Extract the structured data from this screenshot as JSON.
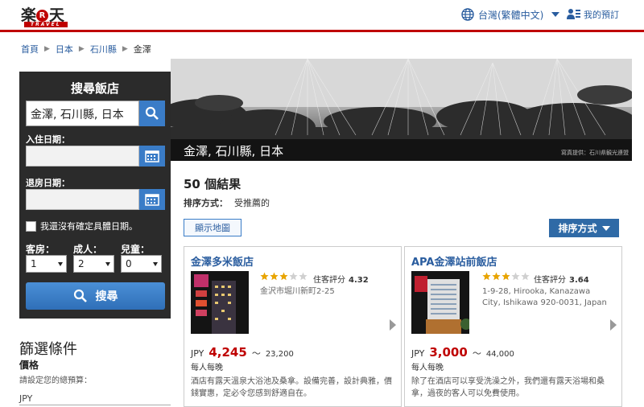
{
  "header": {
    "logo_main_a": "楽",
    "logo_r": "R",
    "logo_main_b": "天",
    "logo_sub": "TRAVEL",
    "language": "台灣(繁體中文)",
    "my_booking": "我的預訂"
  },
  "breadcrumb": [
    "首頁",
    "日本",
    "石川縣",
    "金澤"
  ],
  "search": {
    "title": "搜尋飯店",
    "destination": "金澤, 石川縣, 日本",
    "checkin_label": "入住日期：",
    "checkout_label": "退房日期：",
    "no_date_label": "我還沒有確定具體日期。",
    "rooms_label": "客房：",
    "adults_label": "成人：",
    "children_label": "兒童：",
    "rooms_value": "1",
    "adults_value": "2",
    "children_value": "0",
    "button_label": "搜尋"
  },
  "filter": {
    "title": "篩選條件",
    "price_label": "價格",
    "price_desc": "請設定您的總預算：",
    "currency": "JPY"
  },
  "hero": {
    "title": "金澤, 石川縣, 日本",
    "credit": "寫真提供：石川県観光連盟"
  },
  "results": {
    "count": "50 個結果",
    "sort_label": "排序方式：",
    "sort_value": "受推薦的",
    "map_button": "顯示地圖",
    "sort_button": "排序方式"
  },
  "hotels": [
    {
      "name": "金澤多米飯店",
      "stars": 3,
      "rating_label": "住客評分",
      "rating": "4.32",
      "address": "金沢市堀川新町2-25",
      "currency": "JPY",
      "price": "4,245",
      "tilde": "～",
      "price_max": "23,200",
      "per_night": "每人每晚",
      "desc": "酒店有露天溫泉大浴池及桑拿。設備完善，設計典雅，價錢實惠，定必令您感到舒適自在。"
    },
    {
      "name": "APA金澤站前飯店",
      "stars": 3,
      "rating_label": "住客評分",
      "rating": "3.64",
      "address": "1-9-28, Hirooka, Kanazawa City, Ishikawa 920-0031, Japan",
      "currency": "JPY",
      "price": "3,000",
      "tilde": "～",
      "price_max": "44,000",
      "per_night": "每人每晚",
      "desc": "除了在酒店可以享受洗澡之外，我們還有露天浴場和桑拿，過夜的客人可以免費使用。"
    }
  ],
  "colors": {
    "brand_red": "#bf0000",
    "link_blue": "#2a5d9f",
    "button_blue": "#3a7cc7",
    "panel_dark": "#2b2b2b",
    "star_gold": "#e8a400"
  }
}
